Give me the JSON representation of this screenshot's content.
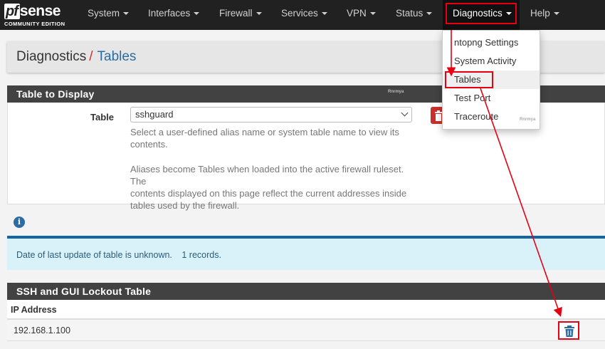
{
  "brand": {
    "logo_pf": "pf",
    "logo_sense": "sense",
    "edition": "COMMUNITY EDITION"
  },
  "nav": {
    "items": [
      {
        "label": "System"
      },
      {
        "label": "Interfaces"
      },
      {
        "label": "Firewall"
      },
      {
        "label": "Services"
      },
      {
        "label": "VPN"
      },
      {
        "label": "Status"
      },
      {
        "label": "Diagnostics"
      },
      {
        "label": "Help"
      }
    ],
    "active": "Diagnostics"
  },
  "breadcrumb": {
    "parent": "Diagnostics",
    "separator": "/",
    "current": "Tables"
  },
  "diagnostics_menu": {
    "items": [
      {
        "label": "ntopng Settings"
      },
      {
        "label": "System Activity"
      },
      {
        "label": "Tables"
      },
      {
        "label": "Test Port"
      },
      {
        "label": "Traceroute"
      }
    ],
    "selected": "Tables"
  },
  "table_panel": {
    "title": "Table to Display",
    "field_label": "Table",
    "selected_table": "sshguard",
    "help_line1": "Select a user-defined alias name or system table name to view its",
    "help_line2": "contents.",
    "help_line3": "Aliases become Tables when loaded into the active firewall ruleset. The",
    "help_line4": "contents displayed on this page reflect the current addresses inside",
    "help_line5": "tables used by the firewall."
  },
  "info": {
    "icon": "info-icon",
    "last_update": "Date of last update of table is unknown.",
    "records": "1 records."
  },
  "lockout_table": {
    "title": "SSH and GUI Lockout Table",
    "column_header": "IP Address",
    "rows": [
      {
        "ip": "192.168.1.100"
      }
    ]
  },
  "watermark": "Rnrmya",
  "colors": {
    "navbar": "#212121",
    "panel_heading": "#424242",
    "highlight": "#e60012",
    "link": "#2d6ca2",
    "info_bg": "#d9f2fa",
    "danger": "#c9302c"
  }
}
